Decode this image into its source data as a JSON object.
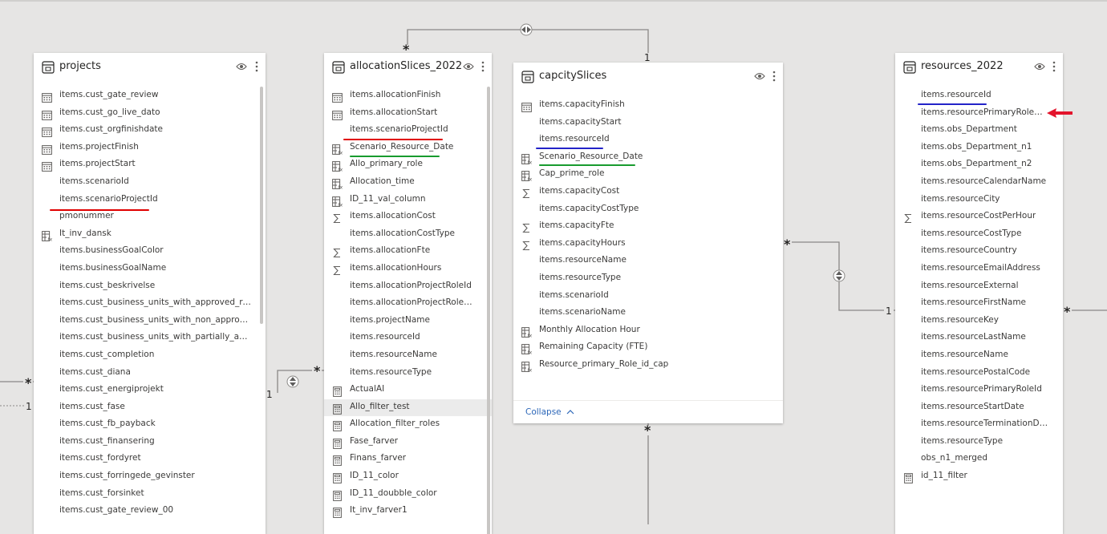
{
  "colors": {
    "underline_red": "#e00000",
    "underline_green": "#189b2e",
    "underline_blue": "#2323c8",
    "arrow_red": "#e3142c"
  },
  "tables": {
    "projects": {
      "title": "projects",
      "fields": [
        {
          "name": "items.cust_gate_review",
          "icon": "calendar-icon"
        },
        {
          "name": "items.cust_go_live_dato",
          "icon": "calendar-icon"
        },
        {
          "name": "items.cust_orgfinishdate",
          "icon": "calendar-icon"
        },
        {
          "name": "items.projectFinish",
          "icon": "calendar-icon"
        },
        {
          "name": "items.projectStart",
          "icon": "calendar-icon"
        },
        {
          "name": "items.scenarioId",
          "icon": ""
        },
        {
          "name": "items.scenarioProjectId",
          "icon": ""
        },
        {
          "name": "pmonummer",
          "icon": ""
        },
        {
          "name": "It_inv_dansk",
          "icon": "calculated-column-icon"
        },
        {
          "name": "items.businessGoalColor",
          "icon": ""
        },
        {
          "name": "items.businessGoalName",
          "icon": ""
        },
        {
          "name": "items.cust_beskrivelse",
          "icon": ""
        },
        {
          "name": "items.cust_business_units_with_approved_resources",
          "icon": ""
        },
        {
          "name": "items.cust_business_units_with_non_approved_resources",
          "icon": ""
        },
        {
          "name": "items.cust_business_units_with_partially_approved_resources",
          "icon": ""
        },
        {
          "name": "items.cust_completion",
          "icon": ""
        },
        {
          "name": "items.cust_diana",
          "icon": ""
        },
        {
          "name": "items.cust_energiprojekt",
          "icon": ""
        },
        {
          "name": "items.cust_fase",
          "icon": ""
        },
        {
          "name": "items.cust_fb_payback",
          "icon": ""
        },
        {
          "name": "items.cust_finansering",
          "icon": ""
        },
        {
          "name": "items.cust_fordyret",
          "icon": ""
        },
        {
          "name": "items.cust_forringede_gevinster",
          "icon": ""
        },
        {
          "name": "items.cust_forsinket",
          "icon": ""
        },
        {
          "name": "items.cust_gate_review_00",
          "icon": ""
        }
      ]
    },
    "allocationSlices": {
      "title": "allocationSlices_2022",
      "fields": [
        {
          "name": "items.allocationFinish",
          "icon": "calendar-icon"
        },
        {
          "name": "items.allocationStart",
          "icon": "calendar-icon"
        },
        {
          "name": "items.scenarioProjectId",
          "icon": ""
        },
        {
          "name": "Scenario_Resource_Date",
          "icon": "calculated-column-icon"
        },
        {
          "name": "Allo_primary_role",
          "icon": "calculated-column-icon"
        },
        {
          "name": "Allocation_time",
          "icon": "calculated-column-icon"
        },
        {
          "name": "ID_11_val_column",
          "icon": "calculated-column-icon"
        },
        {
          "name": "items.allocationCost",
          "icon": "sum-icon"
        },
        {
          "name": "items.allocationCostType",
          "icon": ""
        },
        {
          "name": "items.allocationFte",
          "icon": "sum-icon"
        },
        {
          "name": "items.allocationHours",
          "icon": "sum-icon"
        },
        {
          "name": "items.allocationProjectRoleId",
          "icon": ""
        },
        {
          "name": "items.allocationProjectRoleName",
          "icon": ""
        },
        {
          "name": "items.projectName",
          "icon": ""
        },
        {
          "name": "items.resourceId",
          "icon": ""
        },
        {
          "name": "items.resourceName",
          "icon": ""
        },
        {
          "name": "items.resourceType",
          "icon": ""
        },
        {
          "name": "ActualAI",
          "icon": "measure-icon"
        },
        {
          "name": "Allo_filter_test",
          "icon": "measure-icon"
        },
        {
          "name": "Allocation_filter_roles",
          "icon": "measure-icon"
        },
        {
          "name": "Fase_farver",
          "icon": "measure-icon"
        },
        {
          "name": "Finans_farver",
          "icon": "measure-icon"
        },
        {
          "name": "ID_11_color",
          "icon": "measure-icon"
        },
        {
          "name": "ID_11_doubble_color",
          "icon": "measure-icon"
        },
        {
          "name": "It_inv_farver1",
          "icon": "measure-icon"
        }
      ]
    },
    "capacitySlices": {
      "title": "capcitySlices",
      "collapse_label": "Collapse",
      "fields": [
        {
          "name": "items.capacityFinish",
          "icon": "calendar-icon"
        },
        {
          "name": "items.capacityStart",
          "icon": ""
        },
        {
          "name": "items.resourceId",
          "icon": ""
        },
        {
          "name": "Scenario_Resource_Date",
          "icon": "calculated-column-icon"
        },
        {
          "name": "Cap_prime_role",
          "icon": "calculated-column-icon"
        },
        {
          "name": "items.capacityCost",
          "icon": "sum-icon"
        },
        {
          "name": "items.capacityCostType",
          "icon": ""
        },
        {
          "name": "items.capacityFte",
          "icon": "sum-icon"
        },
        {
          "name": "items.capacityHours",
          "icon": "sum-icon"
        },
        {
          "name": "items.resourceName",
          "icon": ""
        },
        {
          "name": "items.resourceType",
          "icon": ""
        },
        {
          "name": "items.scenarioId",
          "icon": ""
        },
        {
          "name": "items.scenarioName",
          "icon": ""
        },
        {
          "name": "Monthly Allocation Hour",
          "icon": "calculated-column-icon"
        },
        {
          "name": "Remaining Capacity (FTE)",
          "icon": "calculated-column-icon"
        },
        {
          "name": "Resource_primary_Role_id_cap",
          "icon": "calculated-column-icon"
        }
      ]
    },
    "resources": {
      "title": "resources_2022",
      "fields": [
        {
          "name": "items.resourceId",
          "icon": ""
        },
        {
          "name": "items.resourcePrimaryRoleName",
          "icon": ""
        },
        {
          "name": "items.obs_Department",
          "icon": ""
        },
        {
          "name": "items.obs_Department_n1",
          "icon": ""
        },
        {
          "name": "items.obs_Department_n2",
          "icon": ""
        },
        {
          "name": "items.resourceCalendarName",
          "icon": ""
        },
        {
          "name": "items.resourceCity",
          "icon": ""
        },
        {
          "name": "items.resourceCostPerHour",
          "icon": "sum-icon"
        },
        {
          "name": "items.resourceCostType",
          "icon": ""
        },
        {
          "name": "items.resourceCountry",
          "icon": ""
        },
        {
          "name": "items.resourceEmailAddress",
          "icon": ""
        },
        {
          "name": "items.resourceExternal",
          "icon": ""
        },
        {
          "name": "items.resourceFirstName",
          "icon": ""
        },
        {
          "name": "items.resourceKey",
          "icon": ""
        },
        {
          "name": "items.resourceLastName",
          "icon": ""
        },
        {
          "name": "items.resourceName",
          "icon": ""
        },
        {
          "name": "items.resourcePostalCode",
          "icon": ""
        },
        {
          "name": "items.resourcePrimaryRoleId",
          "icon": ""
        },
        {
          "name": "items.resourceStartDate",
          "icon": ""
        },
        {
          "name": "items.resourceTerminationDate",
          "icon": ""
        },
        {
          "name": "items.resourceType",
          "icon": ""
        },
        {
          "name": "obs_n1_merged",
          "icon": ""
        },
        {
          "name": "id_11_filter",
          "icon": "measure-icon"
        }
      ]
    }
  },
  "cardinality": {
    "many": "*",
    "one": "1"
  }
}
